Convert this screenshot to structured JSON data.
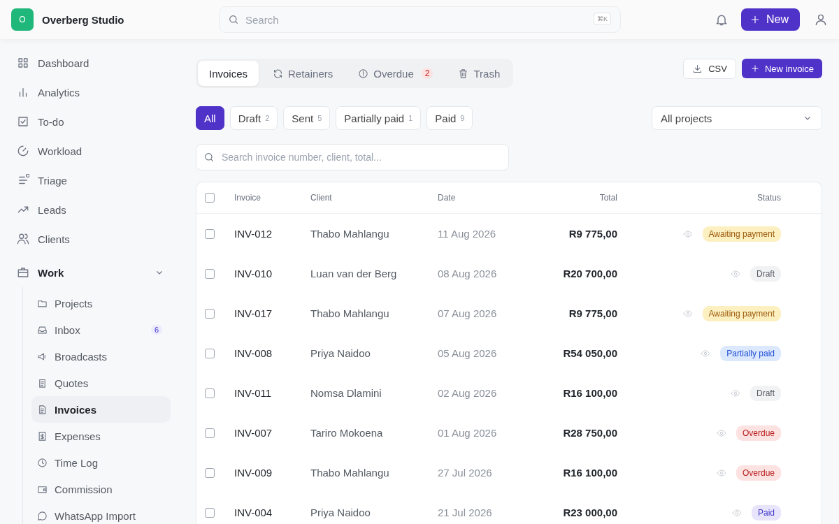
{
  "app": {
    "logo_letter": "O",
    "name": "Overberg Studio"
  },
  "top_search": {
    "placeholder": "Search",
    "shortcut": "⌘K"
  },
  "top_actions": {
    "new_label": "New"
  },
  "sidebar": {
    "items": [
      {
        "label": "Dashboard",
        "selected": false
      },
      {
        "label": "Analytics",
        "selected": false
      },
      {
        "label": "To-do",
        "selected": false
      },
      {
        "label": "Workload",
        "selected": false
      },
      {
        "label": "Triage",
        "selected": false
      },
      {
        "label": "Leads",
        "selected": false
      },
      {
        "label": "Clients",
        "selected": false
      }
    ],
    "group": {
      "label": "Work",
      "expanded": true,
      "children": [
        {
          "label": "Projects",
          "selected": false
        },
        {
          "label": "Inbox",
          "selected": false,
          "badge": "6"
        },
        {
          "label": "Broadcasts",
          "selected": false
        },
        {
          "label": "Quotes",
          "selected": false
        },
        {
          "label": "Invoices",
          "selected": true
        },
        {
          "label": "Expenses",
          "selected": false
        },
        {
          "label": "Time Log",
          "selected": false
        },
        {
          "label": "Commission",
          "selected": false
        },
        {
          "label": "WhatsApp Import",
          "selected": false
        }
      ]
    }
  },
  "tabs": [
    {
      "label": "Invoices",
      "selected": true
    },
    {
      "label": "Retainers",
      "selected": false
    },
    {
      "label": "Overdue",
      "selected": false,
      "badge": "2"
    },
    {
      "label": "Trash",
      "selected": false
    }
  ],
  "actions": {
    "csv": "CSV",
    "new_invoice": "New invoice"
  },
  "filters": [
    {
      "label": "All",
      "selected": true
    },
    {
      "label": "Draft",
      "count": "2",
      "selected": false
    },
    {
      "label": "Sent",
      "count": "5",
      "selected": false
    },
    {
      "label": "Partially paid",
      "count": "1",
      "selected": false
    },
    {
      "label": "Paid",
      "count": "9",
      "selected": false
    }
  ],
  "project_select": {
    "value": "All projects"
  },
  "table_search": {
    "placeholder": "Search invoice number, client, total..."
  },
  "table": {
    "select_all_checked": false,
    "columns": [
      "Invoice",
      "Client",
      "Date",
      "Total",
      "Status"
    ],
    "rows": [
      {
        "checked": false,
        "invoice": "INV-012",
        "client": "Thabo Mahlangu",
        "date": "11 Aug 2026",
        "total": "R9 775,00",
        "status": "Awaiting payment",
        "kind": "awaiting"
      },
      {
        "checked": false,
        "invoice": "INV-010",
        "client": "Luan van der Berg",
        "date": "08 Aug 2026",
        "total": "R20 700,00",
        "status": "Draft",
        "kind": "draft"
      },
      {
        "checked": false,
        "invoice": "INV-017",
        "client": "Thabo Mahlangu",
        "date": "07 Aug 2026",
        "total": "R9 775,00",
        "status": "Awaiting payment",
        "kind": "awaiting"
      },
      {
        "checked": false,
        "invoice": "INV-008",
        "client": "Priya Naidoo",
        "date": "05 Aug 2026",
        "total": "R54 050,00",
        "status": "Partially paid",
        "kind": "partial"
      },
      {
        "checked": false,
        "invoice": "INV-011",
        "client": "Nomsa Dlamini",
        "date": "02 Aug 2026",
        "total": "R16 100,00",
        "status": "Draft",
        "kind": "draft"
      },
      {
        "checked": false,
        "invoice": "INV-007",
        "client": "Tariro Mokoena",
        "date": "01 Aug 2026",
        "total": "R28 750,00",
        "status": "Overdue",
        "kind": "overdue"
      },
      {
        "checked": false,
        "invoice": "INV-009",
        "client": "Thabo Mahlangu",
        "date": "27 Jul 2026",
        "total": "R16 100,00",
        "status": "Overdue",
        "kind": "overdue"
      },
      {
        "checked": false,
        "invoice": "INV-004",
        "client": "Priya Naidoo",
        "date": "21 Jul 2026",
        "total": "R23 000,00",
        "status": "Paid",
        "kind": "paid"
      }
    ]
  }
}
